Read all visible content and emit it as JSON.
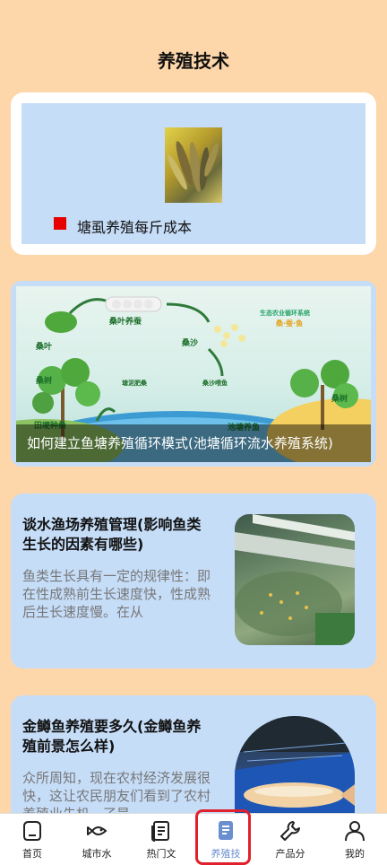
{
  "header": {
    "title": "养殖技术"
  },
  "featured": {
    "label": "塘虱养殖每斤成本",
    "bullet_color": "#e60000"
  },
  "banner": {
    "caption": "如何建立鱼塘养殖循环模式(池塘循环流水养殖系统)",
    "diagram_labels": {
      "mulberry_leaf": "桑叶",
      "leaf_silkworm": "桑叶养蚕",
      "mulberry_sand": "桑沙",
      "system_title": "生态农业循环系统",
      "fish_chain": "桑·蚕·鱼",
      "mulberry_tree_left": "桑树",
      "mulberry_tree_right": "桑树",
      "sand_fish": "桑沙喂鱼",
      "pond_mud": "塘泥肥桑",
      "field_plant": "田埂种桑",
      "pond_fish": "池塘养鱼"
    }
  },
  "articles": [
    {
      "title": "谈水渔场养殖管理(影响鱼类生长的因素有哪些)",
      "desc": "鱼类生长具有一定的规律性：即在性成熟前生长速度快，性成熟后生长速度慢。在从"
    },
    {
      "title": "金鳟鱼养殖要多久(金鳟鱼养殖前景怎么样)",
      "desc": "众所周知，现在农村经济发展很快，这让农民朋友们看到了农村养殖业先机，了是"
    }
  ],
  "nav": {
    "items": [
      {
        "label": "首页",
        "icon": "home-icon"
      },
      {
        "label": "城市水",
        "icon": "fish-icon"
      },
      {
        "label": "热门文",
        "icon": "article-icon"
      },
      {
        "label": "养殖技",
        "icon": "document-icon"
      },
      {
        "label": "产品分",
        "icon": "wrench-icon"
      },
      {
        "label": "我的",
        "icon": "user-icon"
      }
    ],
    "active_index": 3,
    "active_color": "#6a8fcf",
    "highlight_color": "#e0212d"
  }
}
